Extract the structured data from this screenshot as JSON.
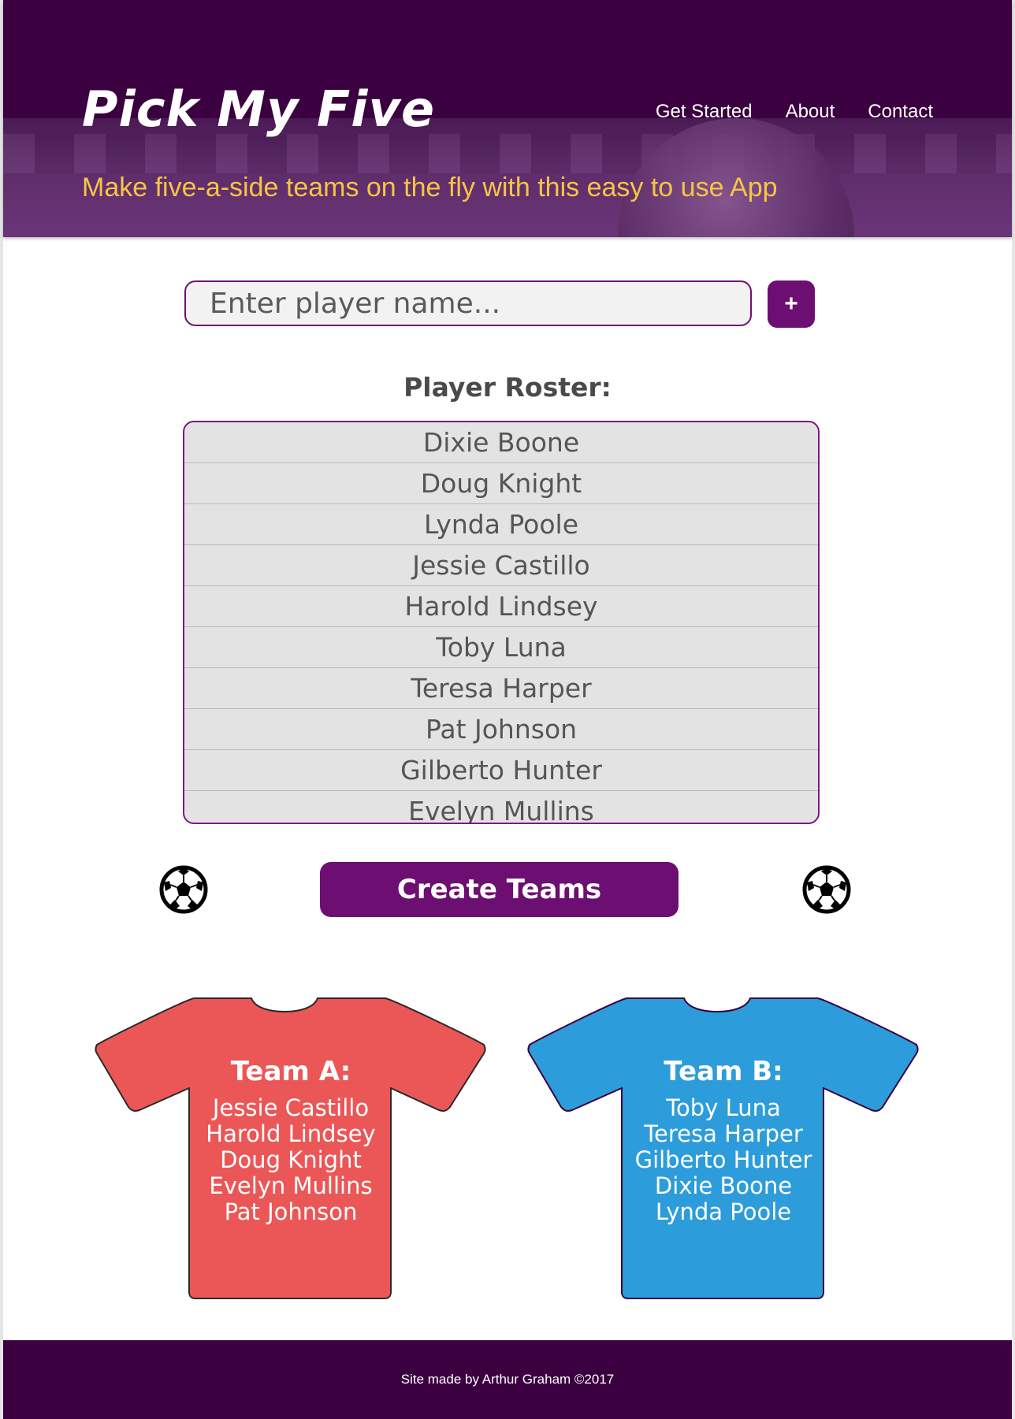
{
  "header": {
    "title": "Pick My Five",
    "tagline": "Make five-a-side teams on the fly with this easy to use App",
    "nav": [
      {
        "label": "Get Started"
      },
      {
        "label": "About"
      },
      {
        "label": "Contact"
      }
    ]
  },
  "input": {
    "placeholder": "Enter player name...",
    "value": "",
    "add_label": "+"
  },
  "roster": {
    "title": "Player Roster:",
    "players": [
      "Dixie Boone",
      "Doug Knight",
      "Lynda Poole",
      "Jessie Castillo",
      "Harold Lindsey",
      "Toby Luna",
      "Teresa Harper",
      "Pat Johnson",
      "Gilberto Hunter",
      "Evelyn Mullins"
    ]
  },
  "create_button": {
    "label": "Create Teams"
  },
  "icons": {
    "left": "soccer-ball-icon",
    "right": "soccer-ball-icon"
  },
  "teams": {
    "a": {
      "title": "Team A:",
      "color": "#eb5757",
      "players": [
        "Jessie Castillo",
        "Harold Lindsey",
        "Doug Knight",
        "Evelyn Mullins",
        "Pat Johnson"
      ]
    },
    "b": {
      "title": "Team B:",
      "color": "#2d9cdb",
      "players": [
        "Toby Luna",
        "Teresa Harper",
        "Gilberto Hunter",
        "Dixie Boone",
        "Lynda Poole"
      ]
    }
  },
  "colors": {
    "primary": "#3a003f",
    "button": "#6d0f72",
    "tagline": "#f6c544"
  },
  "footer": {
    "text": "Site made by Arthur Graham ©2017"
  }
}
